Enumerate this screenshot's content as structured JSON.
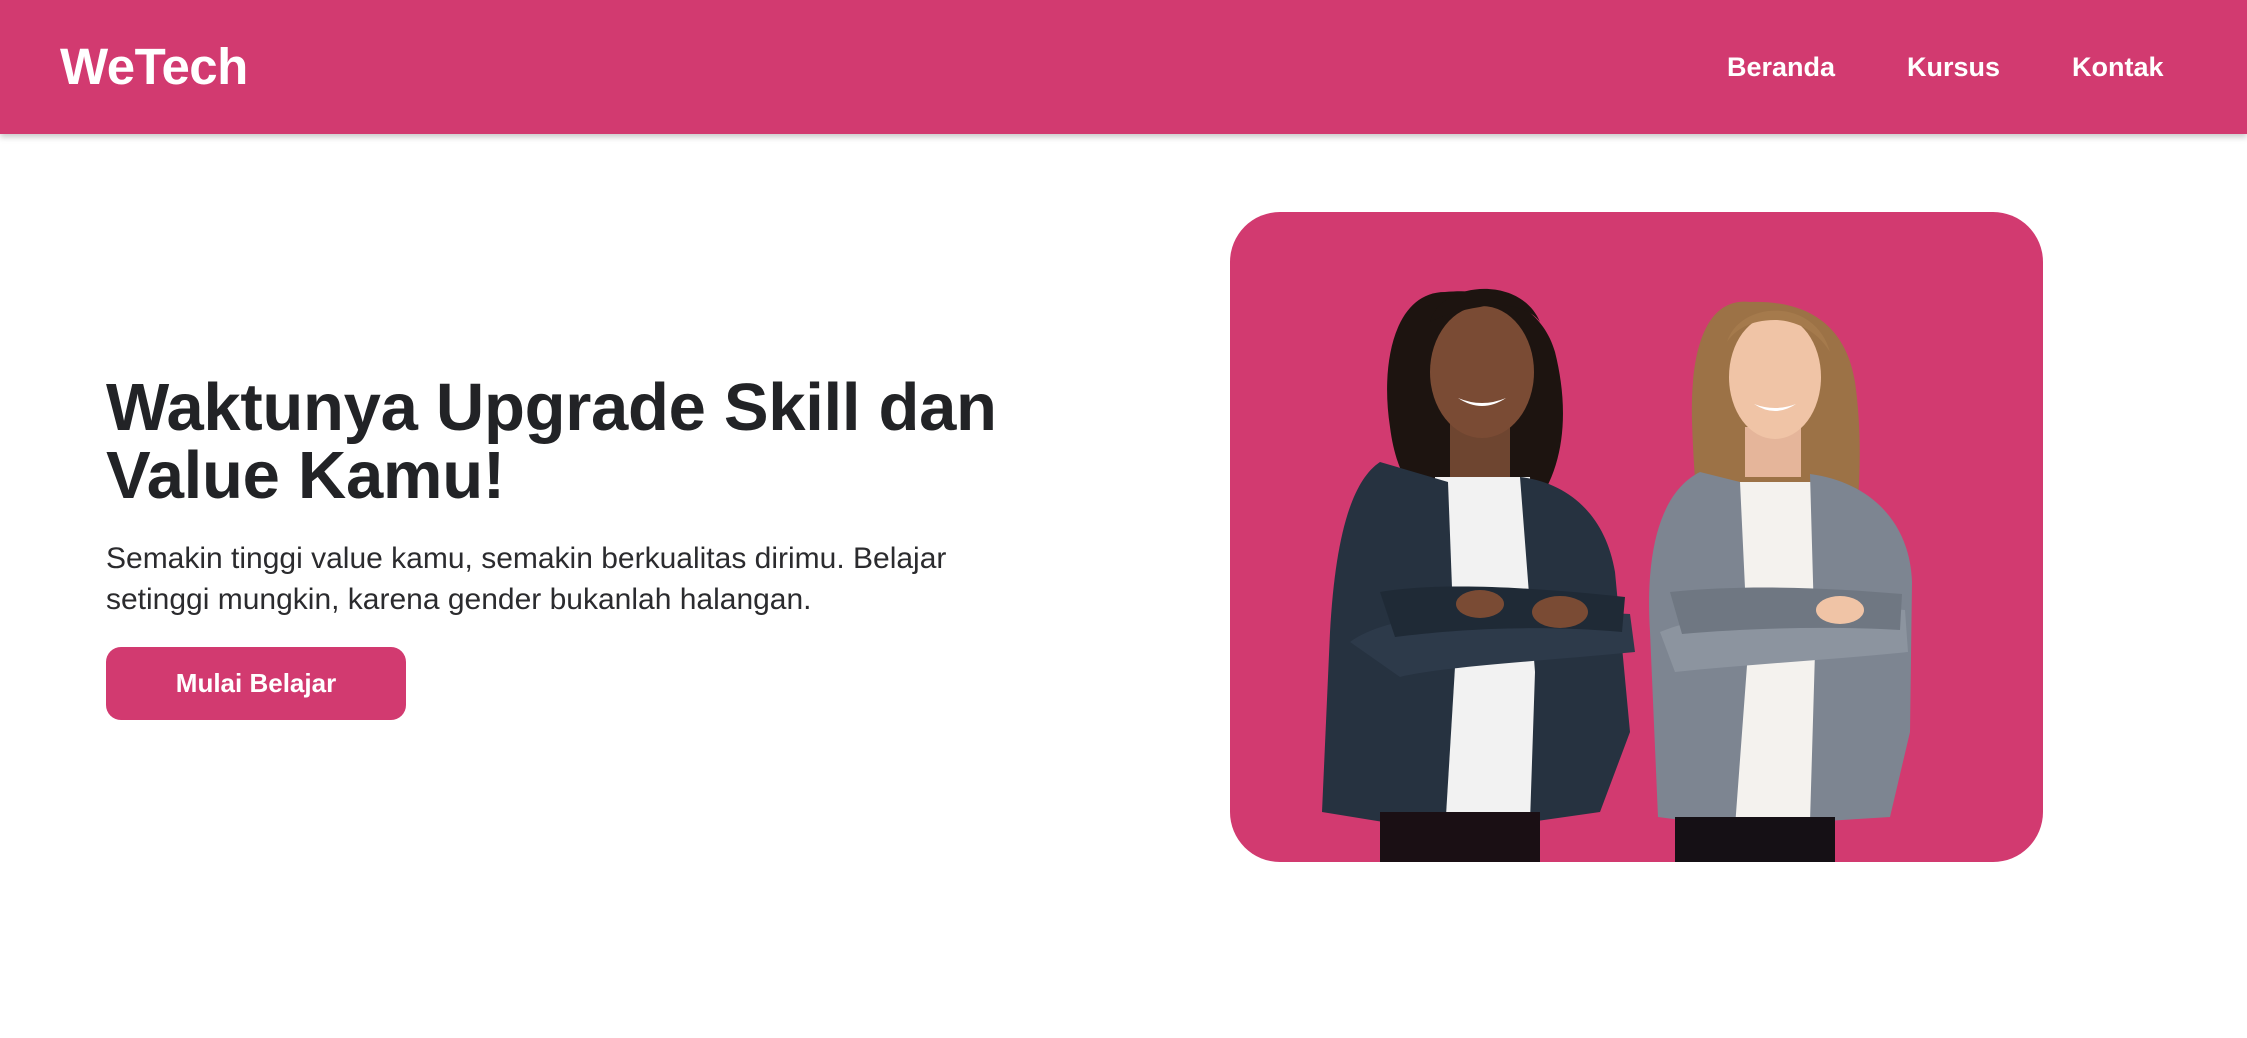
{
  "nav": {
    "brand": "WeTech",
    "links": [
      {
        "label": "Beranda"
      },
      {
        "label": "Kursus"
      },
      {
        "label": "Kontak"
      }
    ]
  },
  "hero": {
    "title_lines": [
      "Waktunya Upgrade Skill dan",
      "Value Kamu!"
    ],
    "description_lines": [
      "Semakin tinggi value kamu, semakin berkualitas dirimu. Belajar",
      "setinggi mungkin, karena gender bukanlah halangan."
    ],
    "cta_label": "Mulai Belajar"
  },
  "colors": {
    "primary": "#d23a70",
    "text_dark": "#222326",
    "background": "#ffffff"
  }
}
